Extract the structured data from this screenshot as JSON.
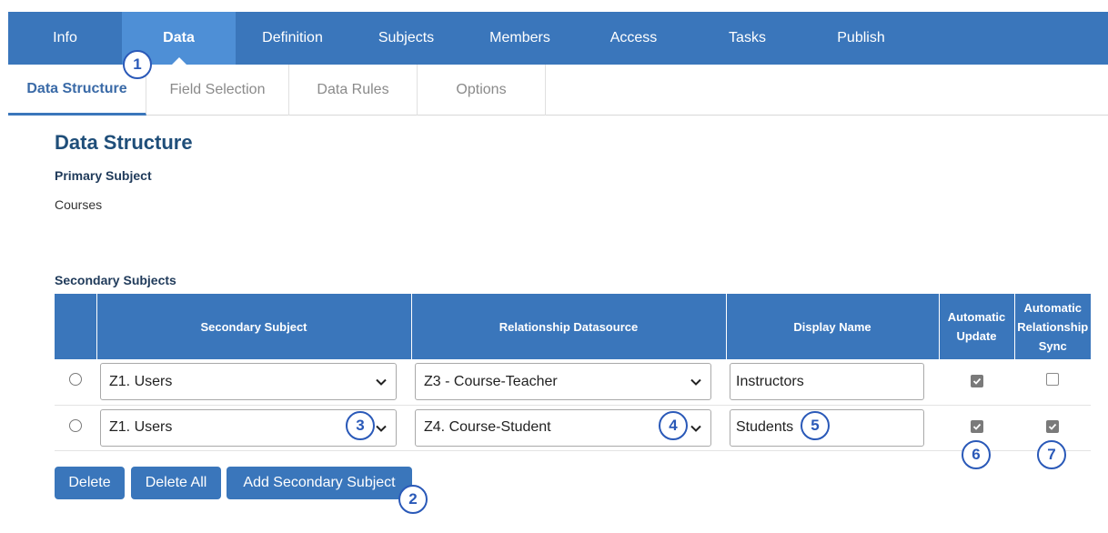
{
  "nav": {
    "tabs": [
      {
        "label": "Info"
      },
      {
        "label": "Data"
      },
      {
        "label": "Definition"
      },
      {
        "label": "Subjects"
      },
      {
        "label": "Members"
      },
      {
        "label": "Access"
      },
      {
        "label": "Tasks"
      },
      {
        "label": "Publish"
      }
    ],
    "active": "Data"
  },
  "subnav": {
    "tabs": [
      {
        "label": "Data Structure"
      },
      {
        "label": "Field Selection"
      },
      {
        "label": "Data Rules"
      },
      {
        "label": "Options"
      }
    ],
    "active": "Data Structure"
  },
  "page": {
    "title": "Data Structure",
    "primary_label": "Primary Subject",
    "primary_value": "Courses",
    "secondary_label": "Secondary Subjects"
  },
  "table": {
    "headers": {
      "secondary_subject": "Secondary Subject",
      "relationship_datasource": "Relationship Datasource",
      "display_name": "Display Name",
      "auto_update_line1": "Automatic",
      "auto_update_line2": "Update",
      "auto_sync_line1": "Automatic",
      "auto_sync_line2": "Relationship",
      "auto_sync_line3": "Sync"
    },
    "rows": [
      {
        "subject": "Z1. Users",
        "datasource": "Z3 - Course-Teacher",
        "display_name": "Instructors",
        "auto_update": true,
        "auto_sync": false
      },
      {
        "subject": "Z1. Users",
        "datasource": "Z4. Course-Student",
        "display_name": "Students",
        "auto_update": true,
        "auto_sync": true
      }
    ]
  },
  "buttons": {
    "delete": "Delete",
    "delete_all": "Delete All",
    "add_secondary": "Add Secondary Subject"
  },
  "callouts": [
    "1",
    "2",
    "3",
    "4",
    "5",
    "6",
    "7"
  ],
  "colors": {
    "nav_bg": "#3a76bb",
    "nav_active": "#4e8fd6",
    "callout": "#2a59b8"
  }
}
